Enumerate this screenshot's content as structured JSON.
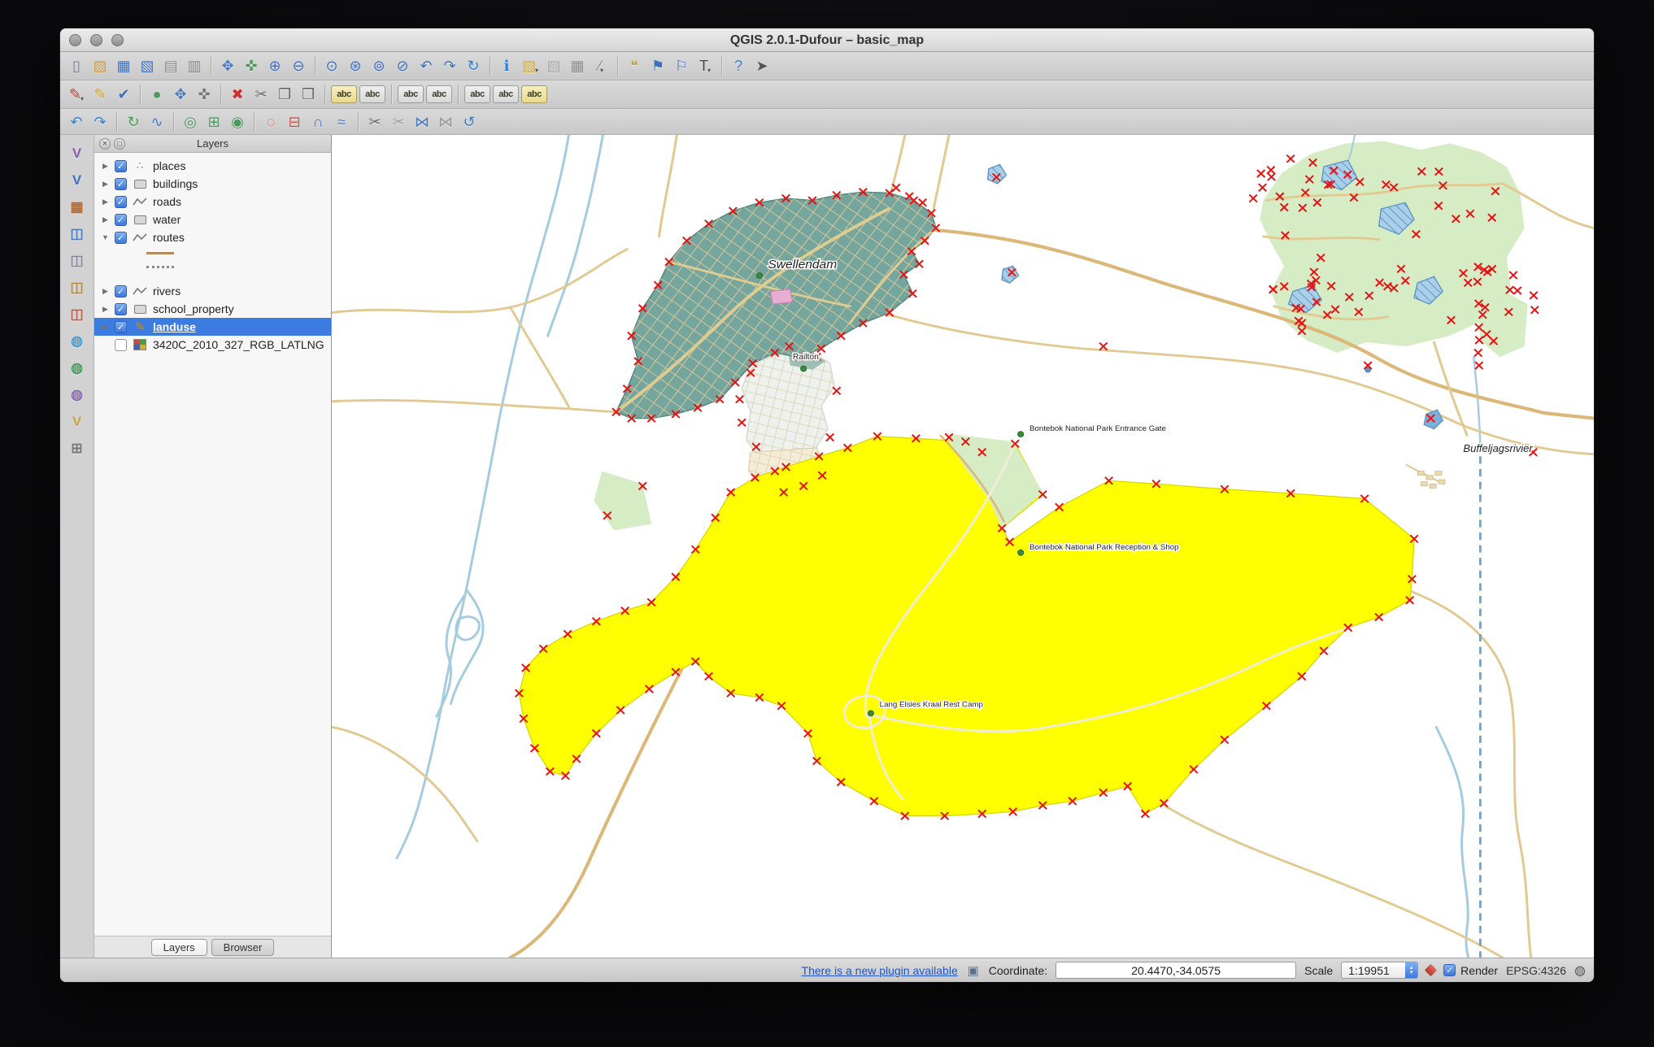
{
  "window": {
    "title": "QGIS 2.0.1-Dufour – basic_map"
  },
  "toolbars": {
    "main": [
      {
        "name": "new-project",
        "glyph": "▯",
        "color": "#6b7b8c"
      },
      {
        "name": "open-project",
        "glyph": "▨",
        "color": "#c8973f"
      },
      {
        "name": "save-project",
        "glyph": "▦",
        "color": "#3f6fbf"
      },
      {
        "name": "save-project-as",
        "glyph": "▧",
        "color": "#3f6fbf"
      },
      {
        "name": "new-composer",
        "glyph": "▤",
        "color": "#8a8a8a"
      },
      {
        "name": "composer-manager",
        "glyph": "▥",
        "color": "#8a8a8a"
      },
      {
        "sep": true
      },
      {
        "name": "pan-map",
        "glyph": "✥",
        "color": "#4a7ac0"
      },
      {
        "name": "pan-to-selection",
        "glyph": "✜",
        "color": "#4a9a5a"
      },
      {
        "name": "zoom-in",
        "glyph": "⊕",
        "color": "#3f6fbf"
      },
      {
        "name": "zoom-out",
        "glyph": "⊖",
        "color": "#3f6fbf"
      },
      {
        "sep": true
      },
      {
        "name": "zoom-native",
        "glyph": "⊙",
        "color": "#3f6fbf"
      },
      {
        "name": "zoom-full",
        "glyph": "⊛",
        "color": "#3f6fbf"
      },
      {
        "name": "zoom-to-selection",
        "glyph": "⊚",
        "color": "#3f6fbf"
      },
      {
        "name": "zoom-to-layer",
        "glyph": "⊘",
        "color": "#3f6fbf"
      },
      {
        "name": "zoom-last",
        "glyph": "↶",
        "color": "#3f6fbf"
      },
      {
        "name": "zoom-next",
        "glyph": "↷",
        "color": "#3f6fbf"
      },
      {
        "name": "map-refresh",
        "glyph": "↻",
        "color": "#2f7fd0"
      },
      {
        "sep": true
      },
      {
        "name": "identify-features",
        "glyph": "ℹ",
        "color": "#2f7fd0"
      },
      {
        "name": "select-features",
        "glyph": "▧",
        "color": "#d0a93a",
        "dd": true
      },
      {
        "name": "deselect-features",
        "glyph": "▧",
        "color": "#a8a8a8"
      },
      {
        "name": "open-attribute-table",
        "glyph": "▦",
        "color": "#8a8a8a"
      },
      {
        "name": "measure",
        "glyph": "∕",
        "color": "#8a8a8a",
        "dd": true
      },
      {
        "sep": true
      },
      {
        "name": "map-tips",
        "glyph": "❝",
        "color": "#caa53f"
      },
      {
        "name": "new-bookmark",
        "glyph": "⚑",
        "color": "#3f6fbf"
      },
      {
        "name": "show-bookmarks",
        "glyph": "⚐",
        "color": "#3f6fbf"
      },
      {
        "name": "text-annotation",
        "glyph": "T",
        "color": "#444",
        "dd": true
      },
      {
        "sep": true
      },
      {
        "name": "help",
        "glyph": "?",
        "color": "#2f7fd0"
      },
      {
        "name": "whats-this",
        "glyph": "➤",
        "color": "#555"
      }
    ],
    "digitizing": [
      {
        "name": "current-edits",
        "glyph": "✎",
        "color": "#b23a2a",
        "dd": true
      },
      {
        "name": "toggle-editing",
        "glyph": "✎",
        "color": "#d4a017"
      },
      {
        "name": "save-layer-edits",
        "glyph": "✔",
        "color": "#3f6fbf"
      },
      {
        "sep": true
      },
      {
        "name": "add-feature",
        "glyph": "●",
        "color": "#4a9a5a"
      },
      {
        "name": "move-feature",
        "glyph": "✥",
        "color": "#4a7ac0"
      },
      {
        "name": "node-tool",
        "glyph": "✜",
        "color": "#777777"
      },
      {
        "sep": true
      },
      {
        "name": "delete-selected",
        "glyph": "✖",
        "color": "#cc2f2f"
      },
      {
        "name": "cut-features",
        "glyph": "✂",
        "color": "#666666"
      },
      {
        "name": "copy-features",
        "glyph": "❐",
        "color": "#666666"
      },
      {
        "name": "paste-features",
        "glyph": "❒",
        "color": "#666666"
      },
      {
        "sep": true
      },
      {
        "name": "labeling",
        "abc": true,
        "variant": "yellow"
      },
      {
        "name": "label-add",
        "abc": true,
        "variant": "plain"
      },
      {
        "sep": true
      },
      {
        "name": "label-move",
        "abc": true,
        "variant": "plain"
      },
      {
        "name": "label-rotate",
        "abc": true,
        "variant": "plain"
      },
      {
        "sep": true
      },
      {
        "name": "label-pin",
        "abc": true,
        "variant": "plain"
      },
      {
        "name": "label-show-hide",
        "abc": true,
        "variant": "plain"
      },
      {
        "name": "label-properties",
        "abc": true,
        "variant": "yellow"
      }
    ],
    "advanced": [
      {
        "name": "undo",
        "glyph": "↶",
        "color": "#2f7fd0"
      },
      {
        "name": "redo",
        "glyph": "↷",
        "color": "#2f7fd0"
      },
      {
        "sep": true
      },
      {
        "name": "rotate-feature",
        "glyph": "↻",
        "color": "#4a9a5a"
      },
      {
        "name": "simplify-feature",
        "glyph": "∿",
        "color": "#4a7ac0"
      },
      {
        "sep": true
      },
      {
        "name": "add-ring",
        "glyph": "◎",
        "color": "#4a9a5a"
      },
      {
        "name": "add-part",
        "glyph": "⊞",
        "color": "#4a9a5a"
      },
      {
        "name": "fill-ring",
        "glyph": "◉",
        "color": "#4a9a5a"
      },
      {
        "sep": true
      },
      {
        "name": "delete-ring",
        "glyph": "◌",
        "color": "#cc4f3f"
      },
      {
        "name": "delete-part",
        "glyph": "⊟",
        "color": "#cc4f3f"
      },
      {
        "name": "reshape-features",
        "glyph": "∩",
        "color": "#4a7ac0"
      },
      {
        "name": "offset-curve",
        "glyph": "≈",
        "color": "#4a7ac0"
      },
      {
        "sep": true
      },
      {
        "name": "split-features",
        "glyph": "✂",
        "color": "#666666"
      },
      {
        "name": "split-parts",
        "glyph": "✂",
        "color": "#9a9a9a"
      },
      {
        "name": "merge-features",
        "glyph": "⋈",
        "color": "#4a7ac0"
      },
      {
        "name": "merge-attributes",
        "glyph": "⋈",
        "color": "#9a9a9a"
      },
      {
        "name": "rotate-point-symbols",
        "glyph": "↺",
        "color": "#4a7ac0"
      }
    ],
    "manage_layers": [
      {
        "name": "new-vector-layer",
        "glyph": "V",
        "color": "#8a5ab0"
      },
      {
        "name": "add-vector-layer",
        "glyph": "V",
        "color": "#3f6fbf"
      },
      {
        "name": "add-raster-layer",
        "glyph": "▦",
        "color": "#b06a3a"
      },
      {
        "name": "add-postgis-layer",
        "glyph": "◫",
        "color": "#4a7ac0"
      },
      {
        "name": "add-spatialite-layer",
        "glyph": "◫",
        "color": "#8a8aa0"
      },
      {
        "name": "add-mssql-layer",
        "glyph": "◫",
        "color": "#b08a4a"
      },
      {
        "name": "add-oracle-layer",
        "glyph": "◫",
        "color": "#c05a4a"
      },
      {
        "name": "add-wms-layer",
        "glyph": "◍",
        "color": "#4a9ad0"
      },
      {
        "name": "add-wcs-layer",
        "glyph": "◍",
        "color": "#4a9a5a"
      },
      {
        "name": "add-wfs-layer",
        "glyph": "◍",
        "color": "#8a6ab0"
      },
      {
        "name": "new-shapefile-layer",
        "glyph": "V",
        "color": "#caa53f"
      },
      {
        "name": "add-delimited-text-layer",
        "glyph": "⊞",
        "color": "#7a7a7a"
      }
    ]
  },
  "layers_panel": {
    "title": "Layers",
    "items": [
      {
        "label": "places",
        "icon": "point",
        "checked": true,
        "expandable": true,
        "expanded": false
      },
      {
        "label": "buildings",
        "icon": "polygon",
        "checked": true,
        "expandable": true,
        "expanded": false
      },
      {
        "label": "roads",
        "icon": "line",
        "checked": true,
        "expandable": true,
        "expanded": false
      },
      {
        "label": "water",
        "icon": "polygon",
        "checked": true,
        "expandable": true,
        "expanded": false
      },
      {
        "label": "routes",
        "icon": "line",
        "checked": true,
        "expandable": true,
        "expanded": true,
        "children": [
          "line-solid",
          "line-dashed"
        ]
      },
      {
        "label": "rivers",
        "icon": "line",
        "checked": true,
        "expandable": true,
        "expanded": false
      },
      {
        "label": "school_property",
        "icon": "polygon",
        "checked": true,
        "expandable": true,
        "expanded": false
      },
      {
        "label": "landuse",
        "icon": "pencil",
        "checked": true,
        "expandable": true,
        "expanded": false,
        "selected": true
      },
      {
        "label": "3420C_2010_327_RGB_LATLNG",
        "icon": "raster",
        "checked": false,
        "expandable": false,
        "expanded": false
      }
    ],
    "tabs": [
      {
        "label": "Layers",
        "active": true
      },
      {
        "label": "Browser",
        "active": false
      }
    ]
  },
  "map": {
    "labels": [
      {
        "id": "swellendam",
        "text": "Swellendam"
      },
      {
        "id": "railton",
        "text": "Railton"
      },
      {
        "id": "entrance",
        "text": "Bontebok National Park Entrance Gate"
      },
      {
        "id": "reception",
        "text": "Bontebok National Park Reception & Shop"
      },
      {
        "id": "restcamp",
        "text": "Lang Elsies Kraal Rest Camp"
      },
      {
        "id": "buffeljagsrivier",
        "text": "Buffeljagsrivier"
      }
    ],
    "colors": {
      "landuse_fill": "#ffff00",
      "urban_fill": "#74a69e",
      "park_fill": "#d6ecc4",
      "road": "#e2c992",
      "water": "#a5cbe0",
      "vertex_marker": "#e41414"
    }
  },
  "status_bar": {
    "plugin_link": "There is a new plugin available",
    "coordinate_label": "Coordinate:",
    "coordinate_value": "20.4470,-34.0575",
    "scale_label": "Scale",
    "scale_value": "1:19951",
    "render_label": "Render",
    "crs": "EPSG:4326"
  }
}
